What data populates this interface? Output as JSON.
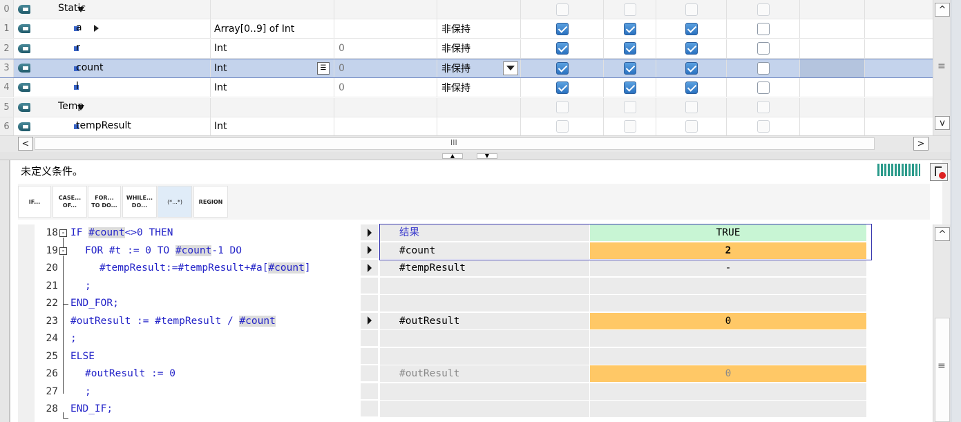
{
  "variables": [
    {
      "num": "0",
      "name": "Static",
      "kind": "section",
      "expanded": true,
      "type": "",
      "default": "",
      "retain": "",
      "checks": [
        "dis",
        "dis",
        "dis",
        "dis"
      ]
    },
    {
      "num": "1",
      "name": "a",
      "kind": "array",
      "type": "Array[0..9] of Int",
      "default": "",
      "retain": "非保持",
      "checks": [
        "on",
        "on",
        "on",
        "off"
      ]
    },
    {
      "num": "2",
      "name": "r",
      "kind": "var",
      "type": "Int",
      "default": "0",
      "retain": "非保持",
      "checks": [
        "on",
        "on",
        "on",
        "off"
      ]
    },
    {
      "num": "3",
      "name": "count",
      "kind": "var",
      "type": "Int",
      "default": "0",
      "retain": "非保持",
      "checks": [
        "on",
        "on",
        "on",
        "off"
      ],
      "selected": true
    },
    {
      "num": "4",
      "name": "l",
      "kind": "var",
      "type": "Int",
      "default": "0",
      "retain": "非保持",
      "checks": [
        "on",
        "on",
        "on",
        "off"
      ]
    },
    {
      "num": "5",
      "name": "Temp",
      "kind": "section",
      "expanded": true,
      "type": "",
      "default": "",
      "retain": "",
      "checks": [
        "dis",
        "dis",
        "dis",
        "dis"
      ]
    },
    {
      "num": "6",
      "name": "tempResult",
      "kind": "var",
      "type": "Int",
      "default": "",
      "retain": "",
      "checks": [
        "dis",
        "dis",
        "dis",
        "dis"
      ]
    }
  ],
  "scroll": {
    "grip": "III",
    "up": "^",
    "down": "v",
    "left": "<",
    "right": ">",
    "lines": "≡"
  },
  "editor": {
    "condition_text": "未定义条件。",
    "keyword_buttons": [
      {
        "l1": "IF...",
        "l2": ""
      },
      {
        "l1": "CASE...",
        "l2": "OF..."
      },
      {
        "l1": "FOR...",
        "l2": "TO DO..."
      },
      {
        "l1": "WHILE...",
        "l2": "DO..."
      },
      {
        "l1": "(*...*)",
        "l2": ""
      },
      {
        "l1": "REGION",
        "l2": ""
      }
    ],
    "code_lines": [
      {
        "n": "18",
        "t": "IF #count<>0 THEN"
      },
      {
        "n": "19",
        "t": "FOR #t := 0 TO #count-1 DO"
      },
      {
        "n": "20",
        "t": "#tempResult:=#tempResult+#a[#count]"
      },
      {
        "n": "21",
        "t": ";"
      },
      {
        "n": "22",
        "t": "END_FOR;"
      },
      {
        "n": "23",
        "t": "#outResult := #tempResult / #count"
      },
      {
        "n": "24",
        "t": ";"
      },
      {
        "n": "25",
        "t": "ELSE"
      },
      {
        "n": "26",
        "t": "#outResult := 0"
      },
      {
        "n": "27",
        "t": ";"
      },
      {
        "n": "28",
        "t": "END_IF;"
      }
    ],
    "monitor_rows": [
      {
        "arrow": true,
        "var": "结果",
        "val": "TRUE",
        "style": "green",
        "var_style": "blue"
      },
      {
        "arrow": true,
        "var": "#count",
        "val": "2",
        "style": "orange"
      },
      {
        "arrow": true,
        "var": "#tempResult",
        "val": "-",
        "style": "grey"
      },
      {
        "arrow": false,
        "var": "",
        "val": "",
        "style": "grey"
      },
      {
        "arrow": false,
        "var": "",
        "val": "",
        "style": "grey"
      },
      {
        "arrow": true,
        "var": "#outResult",
        "val": "0",
        "style": "orange"
      },
      {
        "arrow": false,
        "var": "",
        "val": "",
        "style": "grey"
      },
      {
        "arrow": false,
        "var": "",
        "val": "",
        "style": "grey"
      },
      {
        "arrow": false,
        "var": "#outResult",
        "val": "0",
        "style": "orange",
        "var_style": "dim"
      },
      {
        "arrow": false,
        "var": "",
        "val": "",
        "style": "grey"
      },
      {
        "arrow": false,
        "var": "",
        "val": "",
        "style": "grey"
      }
    ]
  },
  "colors": {
    "selected_row": "#c4d3ec",
    "monitor_orange": "#ffc866",
    "monitor_green": "#c8f5d4",
    "code_blue": "#2323c8"
  }
}
